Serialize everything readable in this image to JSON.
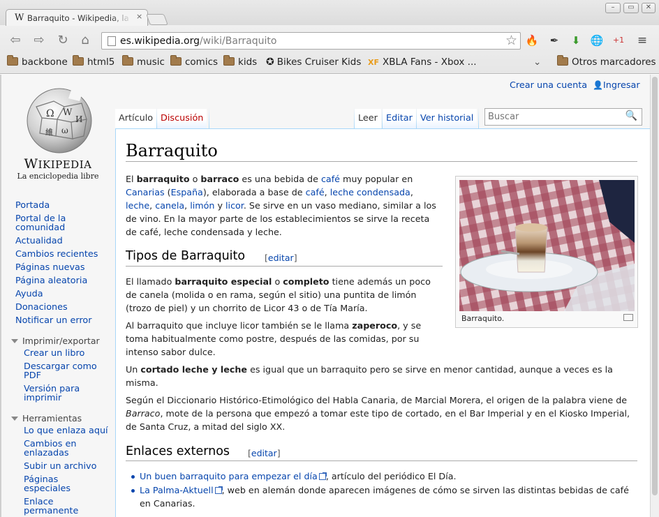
{
  "tab": {
    "favicon": "W",
    "title": "Barraquito - Wikipedia, la enciclopedia libre",
    "close": "×"
  },
  "toolbar": {
    "url_host": "es.wikipedia.org",
    "url_path": "/wiki/Barraquito",
    "back_icon": "back-arrow-icon",
    "forward_icon": "forward-arrow-icon",
    "reload_icon": "reload-icon",
    "home_icon": "home-icon"
  },
  "bookmarks": [
    {
      "label": "backbone",
      "icon": "folder"
    },
    {
      "label": "html5",
      "icon": "folder"
    },
    {
      "label": "music",
      "icon": "folder"
    },
    {
      "label": "comics",
      "icon": "folder"
    },
    {
      "label": "kids",
      "icon": "folder"
    },
    {
      "label": "Bikes Cruiser Kids",
      "icon": "gear"
    },
    {
      "label": "XBLA Fans - Xbox ...",
      "icon": "xf"
    }
  ],
  "bookmarks_other": "Otros marcadores",
  "personal": {
    "create_account": "Crear una cuenta",
    "login": "Ingresar"
  },
  "logo": {
    "wordmark_big": "W",
    "wordmark_rest": "IKIPEDIA",
    "wordmark_end": "",
    "tagline": "La enciclopedia libre"
  },
  "sidebar": {
    "nav": [
      "Portada",
      "Portal de la",
      "comunidad",
      "Actualidad",
      "Cambios recientes",
      "Páginas nuevas",
      "Página aleatoria",
      "Ayuda",
      "Donaciones",
      "Notificar un error"
    ],
    "print_head": "Imprimir/exportar",
    "print_items": [
      "Crear un libro",
      "Descargar como",
      "PDF",
      "Versión para",
      "imprimir"
    ],
    "tools_head": "Herramientas",
    "tools_items": [
      "Lo que enlaza aquí",
      "Cambios en",
      "enlazadas",
      "Subir un archivo",
      "Páginas",
      "especiales",
      "Enlace",
      "permanente"
    ]
  },
  "tabs": {
    "article": "Artículo",
    "talk": "Discusión",
    "read": "Leer",
    "edit": "Editar",
    "history": "Ver historial"
  },
  "search": {
    "placeholder": "Buscar"
  },
  "article": {
    "title": "Barraquito",
    "image_caption": "Barraquito.",
    "intro": {
      "l1a": "El ",
      "l1b": "barraquito",
      "l1c": " o ",
      "l1d": "barraco",
      "l1e": " es una bebida de ",
      "l1f": "café",
      "l1g": " muy popular en",
      "l2a": "Canarias",
      "l2b": " (",
      "l2c": "España",
      "l2d": "), elaborada a base de ",
      "l2e": "café",
      "l2f": ", ",
      "l2g": "leche condensada",
      "l2h": ",",
      "l3a": "leche",
      "l3b": ", ",
      "l3c": "canela",
      "l3d": ", ",
      "l3e": "limón",
      "l3f": " y ",
      "l3g": "licor",
      "l3h": ". Se sirve en un vaso mediano, similar a los",
      "l4": "de vino. En la mayor parte de los establecimientos se sirve la receta",
      "l5": "de café, leche condensada y leche."
    },
    "h_tipos": "Tipos de Barraquito",
    "edit_label": "editar",
    "tipos_p1": {
      "l1a": "El llamado ",
      "l1b": "barraquito especial",
      "l1c": " o ",
      "l1d": "completo",
      "l1e": " tiene además un poco",
      "l2": "de canela (molida o en rama, según el sitio) una puntita de limón",
      "l3": "(trozo de piel) y un chorrito de Licor 43 o de Tía María."
    },
    "tipos_p2": {
      "l1a": "Al barraquito que incluye licor también se le llama ",
      "l1b": "zaperoco",
      "l1c": ", y se",
      "l2": "toma habitualmente como postre, después de las comidas, por su",
      "l3": "intenso sabor dulce."
    },
    "tipos_p3": {
      "l1a": "Un ",
      "l1b": "cortado leche y leche",
      "l1c": " es igual que un barraquito pero se sirve en menor cantidad, aunque a veces es la",
      "l2": "misma."
    },
    "tipos_p4": {
      "l1": "Según el Diccionario Histórico-Etimológico del Habla Canaria, de Marcial Morera, el origen de la palabra viene de",
      "l2a": "Barraco",
      "l2b": ", mote de la persona que empezó a tomar este tipo de cortado, en el Bar Imperial y en el Kiosko Imperial,",
      "l3": "de Santa Cruz, a mitad del siglo XX."
    },
    "h_enlaces": "Enlaces externos",
    "links": [
      {
        "link": "Un buen barraquito para empezar el día",
        "rest": ", artículo del periódico El Día."
      },
      {
        "link": "La Palma-Aktuell",
        "rest": ", web en alemán donde aparecen imágenes de cómo se sirven las distintas bebidas de café",
        "rest2": "en Canarias."
      }
    ]
  },
  "colors": {
    "link": "#0645ad",
    "redlink": "#ba0000",
    "chrome": "#e6e6e6",
    "border": "#a7d7f9"
  }
}
